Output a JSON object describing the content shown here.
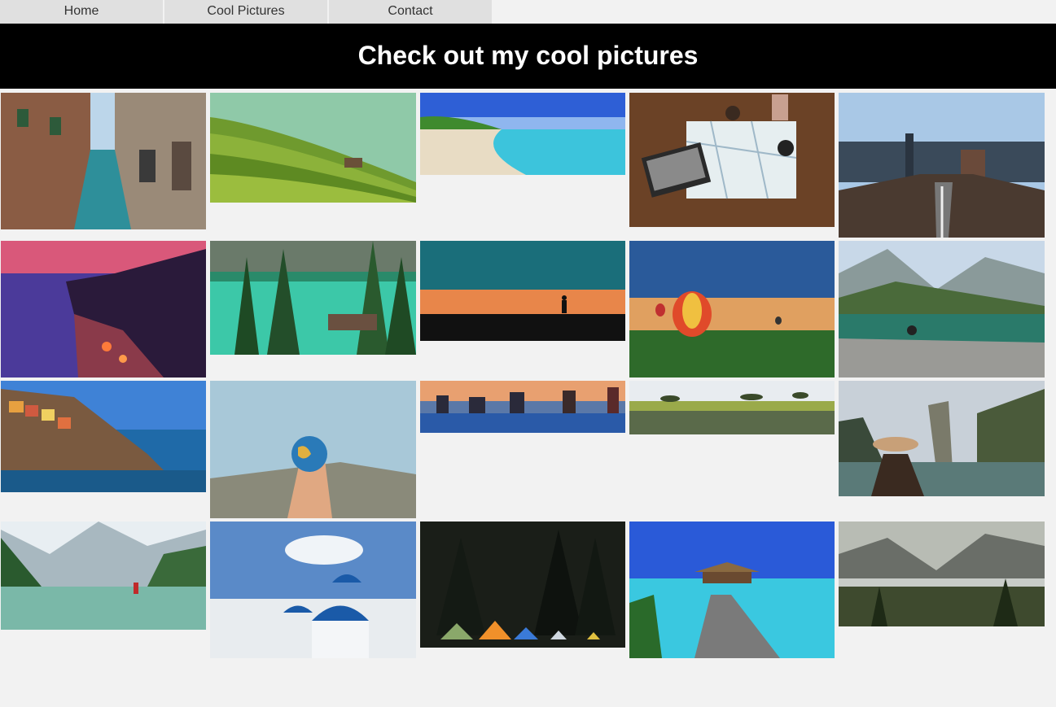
{
  "nav": {
    "home": "Home",
    "pictures": "Cool Pictures",
    "contact": "Contact"
  },
  "header": {
    "title": "Check out my cool pictures"
  },
  "gallery": {
    "photos": [
      "venice-canal",
      "rice-terraces",
      "tropical-beach",
      "travel-map-desk",
      "brooklyn-bridge",
      "cinque-terre-sunset",
      "turquoise-lake-pines",
      "hiker-silhouette-sunset",
      "hot-air-balloons",
      "mountain-lake-couple",
      "colorful-coastal-village",
      "hand-holding-globe",
      "city-skyline-river",
      "savanna-reflection",
      "woman-sea-rocks",
      "alpine-lake-reflection",
      "santorini-domes",
      "forest-camping-tents",
      "overwater-bungalow-pier",
      "misty-mountain-valley"
    ]
  }
}
